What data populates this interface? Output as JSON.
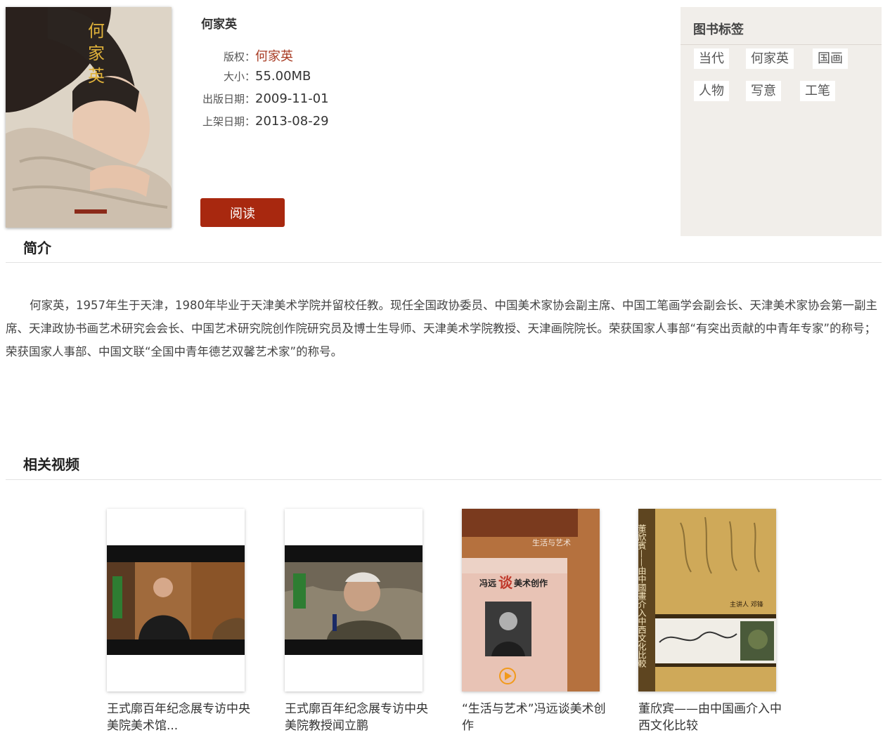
{
  "book": {
    "title": "何家英",
    "copyright_label": "版权：",
    "copyright_value": "何家英",
    "size_label": "大小：",
    "size_value": "55.00MB",
    "publish_label": "出版日期：",
    "publish_value": "2009-11-01",
    "shelf_label": "上架日期：",
    "shelf_value": "2013-08-29",
    "read_label": "阅读",
    "cover_text": "何家英"
  },
  "tags": {
    "title": "图书标签",
    "items": [
      "当代",
      "何家英",
      "国画",
      "人物",
      "写意",
      "工笔"
    ]
  },
  "intro": {
    "title": "简介",
    "text": "何家英，1957年生于天津，1980年毕业于天津美术学院并留校任教。现任全国政协委员、中国美术家协会副主席、中国工笔画学会副会长、天津美术家协会第一副主席、天津政协书画艺术研究会会长、中国艺术研究院创作院研究员及博士生导师、天津美术学院教授、天津画院院长。荣获国家人事部“有突出贡献的中青年专家”的称号；荣获国家人事部、中国文联“全国中青年德艺双馨艺术家”的称号。"
  },
  "videos": {
    "title": "相关视频",
    "items": [
      {
        "title": "王式廓百年纪念展专访中央美院美术馆..."
      },
      {
        "title": "王式廓百年纪念展专访中央美院教授闻立鹏"
      },
      {
        "title": "“生活与艺术”冯远谈美术创作",
        "cover_series": "生活与艺术",
        "cover_title_a": "冯远",
        "cover_title_b": "谈",
        "cover_title_c": "美术创作"
      },
      {
        "title": "董欣宾——由中国画介入中西文化比较",
        "cover_side": "董欣賓——由中國畫介入中西文化比較",
        "cover_speaker": "主讲人  邓锋"
      }
    ]
  },
  "colors": {
    "accent": "#a8280f",
    "tag_panel_bg": "#f1eeea",
    "copyright_text": "#a83c24"
  }
}
